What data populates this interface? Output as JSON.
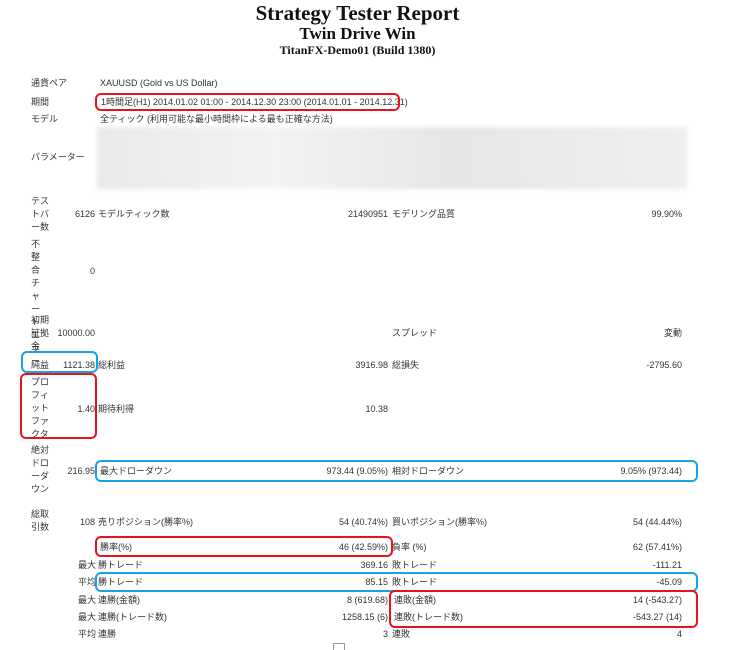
{
  "report": {
    "title": "Strategy Tester Report",
    "ea_name": "Twin Drive Win",
    "account": "TitanFX-Demo01 (Build 1380)"
  },
  "settings": {
    "symbol_label": "通貨ペア",
    "symbol_value": "XAUUSD (Gold vs US Dollar)",
    "period_label": "期間",
    "period_value": "1時間足(H1) 2014.01.02 01:00 - 2014.12.30 23:00 (2014.01.01 - 2014.12.31)",
    "model_label": "モデル",
    "model_value": "全ティック (利用可能な最小時間枠による最も正確な方法)",
    "params_label": "パラメーター"
  },
  "test": {
    "bars_label": "テストバー数",
    "bars_value": "6126",
    "ticks_label": "モデルティック数",
    "ticks_value": "21490951",
    "quality_label": "モデリング品質",
    "quality_value": "99.90%",
    "mismatch_label": "不整合チャートエラー",
    "mismatch_value": "0",
    "deposit_label": "初期証拠金",
    "deposit_value": "10000.00",
    "spread_label": "スプレッド",
    "spread_value": "変動"
  },
  "results": {
    "net_label": "純益",
    "net_value": "1121.38",
    "gross_profit_label": "総利益",
    "gross_profit_value": "3916.98",
    "gross_loss_label": "総損失",
    "gross_loss_value": "-2795.60",
    "pf_label": "プロフィットファクタ",
    "pf_value": "1.40",
    "expected_label": "期待利得",
    "expected_value": "10.38",
    "abs_dd_label": "絶対ドローダウン",
    "abs_dd_value": "216.95",
    "max_dd_label": "最大ドローダウン",
    "max_dd_value": "973.44 (9.05%)",
    "rel_dd_label": "相対ドローダウン",
    "rel_dd_value": "9.05% (973.44)",
    "trades_label": "総取引数",
    "trades_value": "108",
    "short_label": "売りポジション(勝率%)",
    "short_value": "54 (40.74%)",
    "long_label": "買いポジション(勝率%)",
    "long_value": "54 (44.44%)",
    "win_rate_label": "勝率(%)",
    "win_rate_value": "46 (42.59%)",
    "loss_rate_label": "負率 (%)",
    "loss_rate_value": "62 (57.41%)",
    "max_prefix": "最大",
    "avg_prefix": "平均",
    "max_win_label": "勝トレード",
    "max_win_value": "369.16",
    "max_loss_label": "敗トレード",
    "max_loss_value": "-111.21",
    "avg_win_label": "勝トレード",
    "avg_win_value": "85.15",
    "avg_loss_label": "敗トレード",
    "avg_loss_value": "-45.09",
    "cons_win_amt_label": "連勝(金額)",
    "cons_win_amt_value": "8 (619.68)",
    "cons_loss_amt_label": "連敗(金額)",
    "cons_loss_amt_value": "14 (-543.27)",
    "cons_win_cnt_label": "連勝(トレード数)",
    "cons_win_cnt_value": "1258.15 (6)",
    "cons_loss_cnt_label": "連敗(トレード数)",
    "cons_loss_cnt_value": "-543.27 (14)",
    "avg_cons_win_label": "連勝",
    "avg_cons_win_value": "3",
    "avg_cons_loss_label": "連敗",
    "avg_cons_loss_value": "4"
  }
}
